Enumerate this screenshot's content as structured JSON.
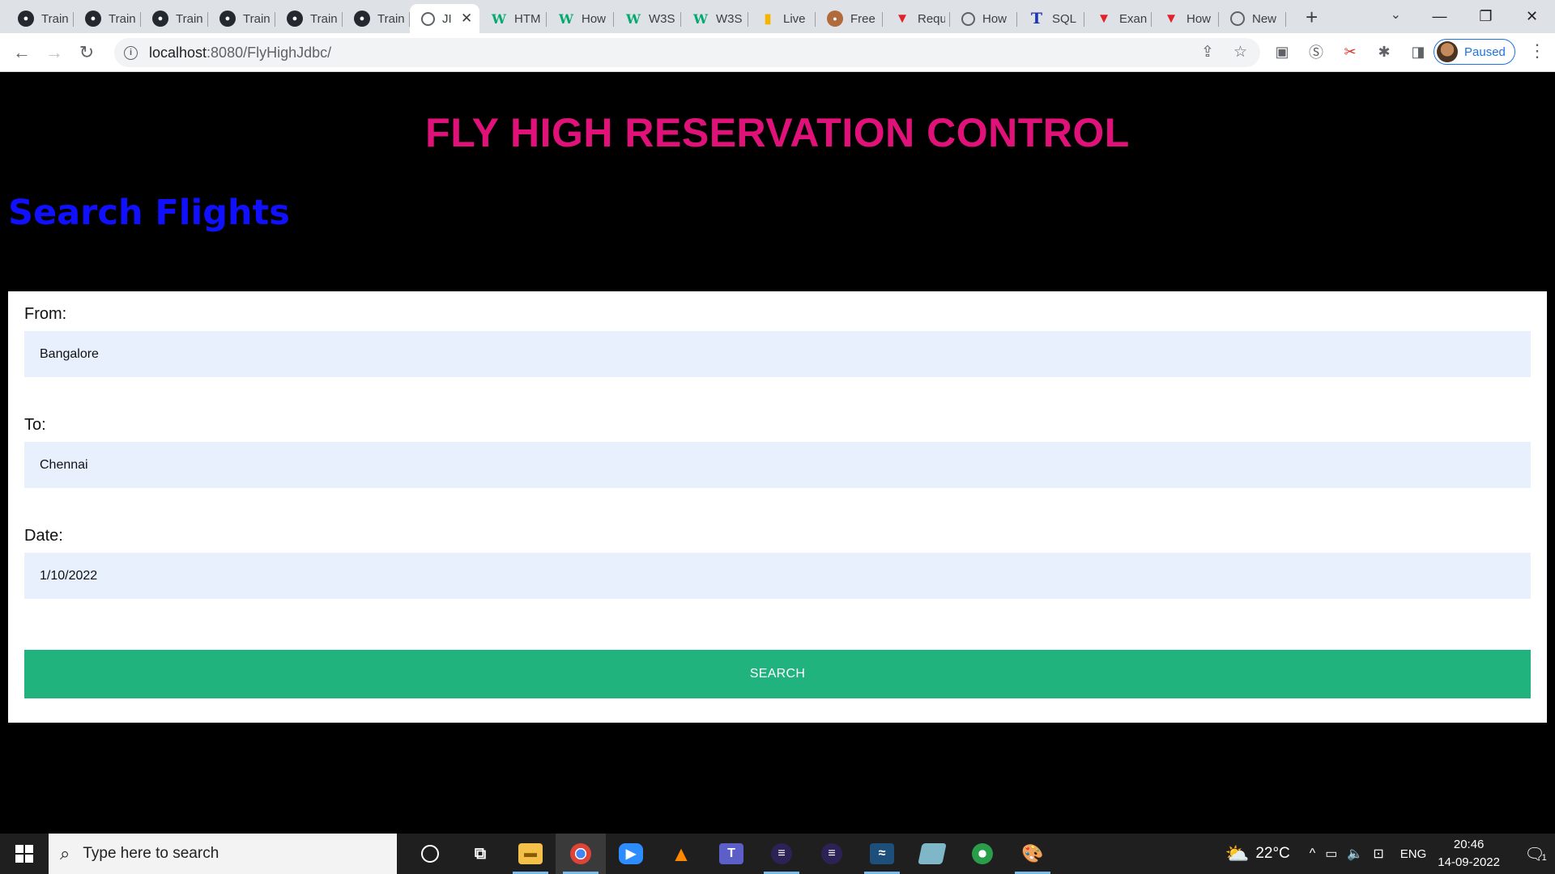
{
  "browser": {
    "tabs": [
      {
        "label": "Train",
        "icon": "github-icon"
      },
      {
        "label": "Train",
        "icon": "github-icon"
      },
      {
        "label": "Train",
        "icon": "github-icon"
      },
      {
        "label": "Train",
        "icon": "github-icon"
      },
      {
        "label": "Train",
        "icon": "github-icon"
      },
      {
        "label": "Train",
        "icon": "github-icon"
      },
      {
        "label": "JI",
        "icon": "globe-icon",
        "active": true
      },
      {
        "label": "HTM",
        "icon": "w3schools-icon"
      },
      {
        "label": "How",
        "icon": "w3schools-icon"
      },
      {
        "label": "W3S",
        "icon": "w3schools-icon"
      },
      {
        "label": "W3S",
        "icon": "w3schools-icon"
      },
      {
        "label": "Live",
        "icon": "live-icon"
      },
      {
        "label": "Free",
        "icon": "free-icon"
      },
      {
        "label": "Requ",
        "icon": "triangle-icon"
      },
      {
        "label": "How",
        "icon": "globe-icon"
      },
      {
        "label": "SQL",
        "icon": "t-icon"
      },
      {
        "label": "Exan",
        "icon": "triangle-icon"
      },
      {
        "label": "How",
        "icon": "triangle-icon"
      },
      {
        "label": "New",
        "icon": "chrome-new-icon"
      }
    ],
    "url_host": "localhost",
    "url_path": ":8080/FlyHighJdbc/",
    "profile_status": "Paused"
  },
  "page": {
    "brand_title": "FLY HIGH RESERVATION CONTROL",
    "section_title": "Search Flights",
    "form": {
      "from_label": "From:",
      "from_value": "Bangalore",
      "to_label": "To:",
      "to_value": "Chennai",
      "date_label": "Date:",
      "date_value": "1/10/2022",
      "submit_label": "SEARCH"
    }
  },
  "taskbar": {
    "search_placeholder": "Type here to search",
    "temperature": "22°C",
    "language": "ENG",
    "time": "20:46",
    "date": "14-09-2022",
    "notification_count": "1"
  },
  "colors": {
    "brand": "#e0127a",
    "section_title": "#1010ff",
    "button": "#20b37d",
    "input_bg": "#e8f0fe"
  }
}
